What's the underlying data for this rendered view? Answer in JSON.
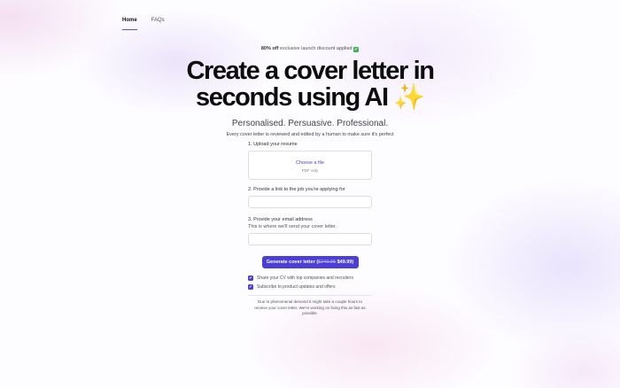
{
  "nav": {
    "items": [
      {
        "label": "Home",
        "active": true
      },
      {
        "label": "FAQs",
        "active": false
      }
    ]
  },
  "promo": {
    "bold": "80% off",
    "text": "exclusive launch discount applied",
    "emoji": "✔"
  },
  "hero": {
    "title_line1": "Create a cover letter in",
    "title_line2": "seconds using AI",
    "sparkle": "✨",
    "subtitle": "Personalised. Persuasive. Professional.",
    "tagline": "Every cover letter is reviewed and edited by a human to make sure it's perfect"
  },
  "form": {
    "resume_label": "1. Upload your resume",
    "upload_link": "Choose a file",
    "upload_hint": "PDF only",
    "job_label": "2. Provide a link to the job you're applying for",
    "job_value": "",
    "email_label": "3. Provide your email address",
    "email_hint": "This is where we'll send your cover letter.",
    "email_value": "",
    "submit_label": "Generate cover letter (",
    "old_price": "$249.95",
    "new_price": "$49.99)",
    "checkbox_mark": "✔",
    "share_cv": "Share your CV with top companies and recruiters",
    "subscribe": "Subscribe to product updates and offers",
    "notice": "Due to phenomenal demand it might take a couple hours to receive your cover letter. We're working on fixing this as fast as possible."
  },
  "colors": {
    "accent": "#4a3fd8",
    "check_green": "#3bb54a"
  }
}
